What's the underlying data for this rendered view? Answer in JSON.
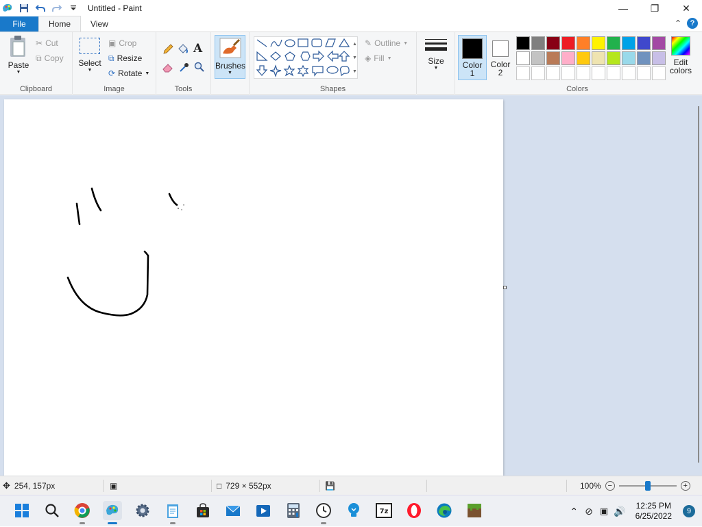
{
  "window": {
    "title": "Untitled - Paint"
  },
  "tabs": [
    {
      "label": "File"
    },
    {
      "label": "Home"
    },
    {
      "label": "View"
    }
  ],
  "ribbon": {
    "clipboard": {
      "paste": "Paste",
      "cut": "Cut",
      "copy": "Copy",
      "label": "Clipboard"
    },
    "image": {
      "select": "Select",
      "crop": "Crop",
      "resize": "Resize",
      "rotate": "Rotate",
      "label": "Image"
    },
    "tools": {
      "label": "Tools"
    },
    "brushes": {
      "label": "Brushes"
    },
    "shapes": {
      "outline": "Outline",
      "fill": "Fill",
      "label": "Shapes"
    },
    "size": {
      "label": "Size"
    },
    "color1": {
      "label1": "Color",
      "label2": "1"
    },
    "color2": {
      "label1": "Color",
      "label2": "2"
    },
    "edit_colors": {
      "label1": "Edit",
      "label2": "colors"
    },
    "colors": {
      "label": "Colors",
      "row1": [
        "#000000",
        "#7f7f7f",
        "#880015",
        "#ed1c24",
        "#ff7f27",
        "#fff200",
        "#22b14c",
        "#00a2e8",
        "#3f48cc",
        "#a349a4"
      ],
      "row2": [
        "#ffffff",
        "#c3c3c3",
        "#b97a57",
        "#ffaec9",
        "#ffc90e",
        "#efe4b0",
        "#b5e61d",
        "#99d9ea",
        "#7092be",
        "#c8bfe7"
      ],
      "row3": [
        "#ffffff",
        "#ffffff",
        "#ffffff",
        "#ffffff",
        "#ffffff",
        "#ffffff",
        "#ffffff",
        "#ffffff",
        "#ffffff",
        "#ffffff"
      ]
    },
    "accent": "#1979ca"
  },
  "status": {
    "cursor": "254, 157px",
    "size": "729 × 552px",
    "zoom": "100%",
    "zoom_level": 0.5
  },
  "taskbar": {
    "time": "12:25 PM",
    "date": "6/25/2022",
    "notifications": "9"
  }
}
